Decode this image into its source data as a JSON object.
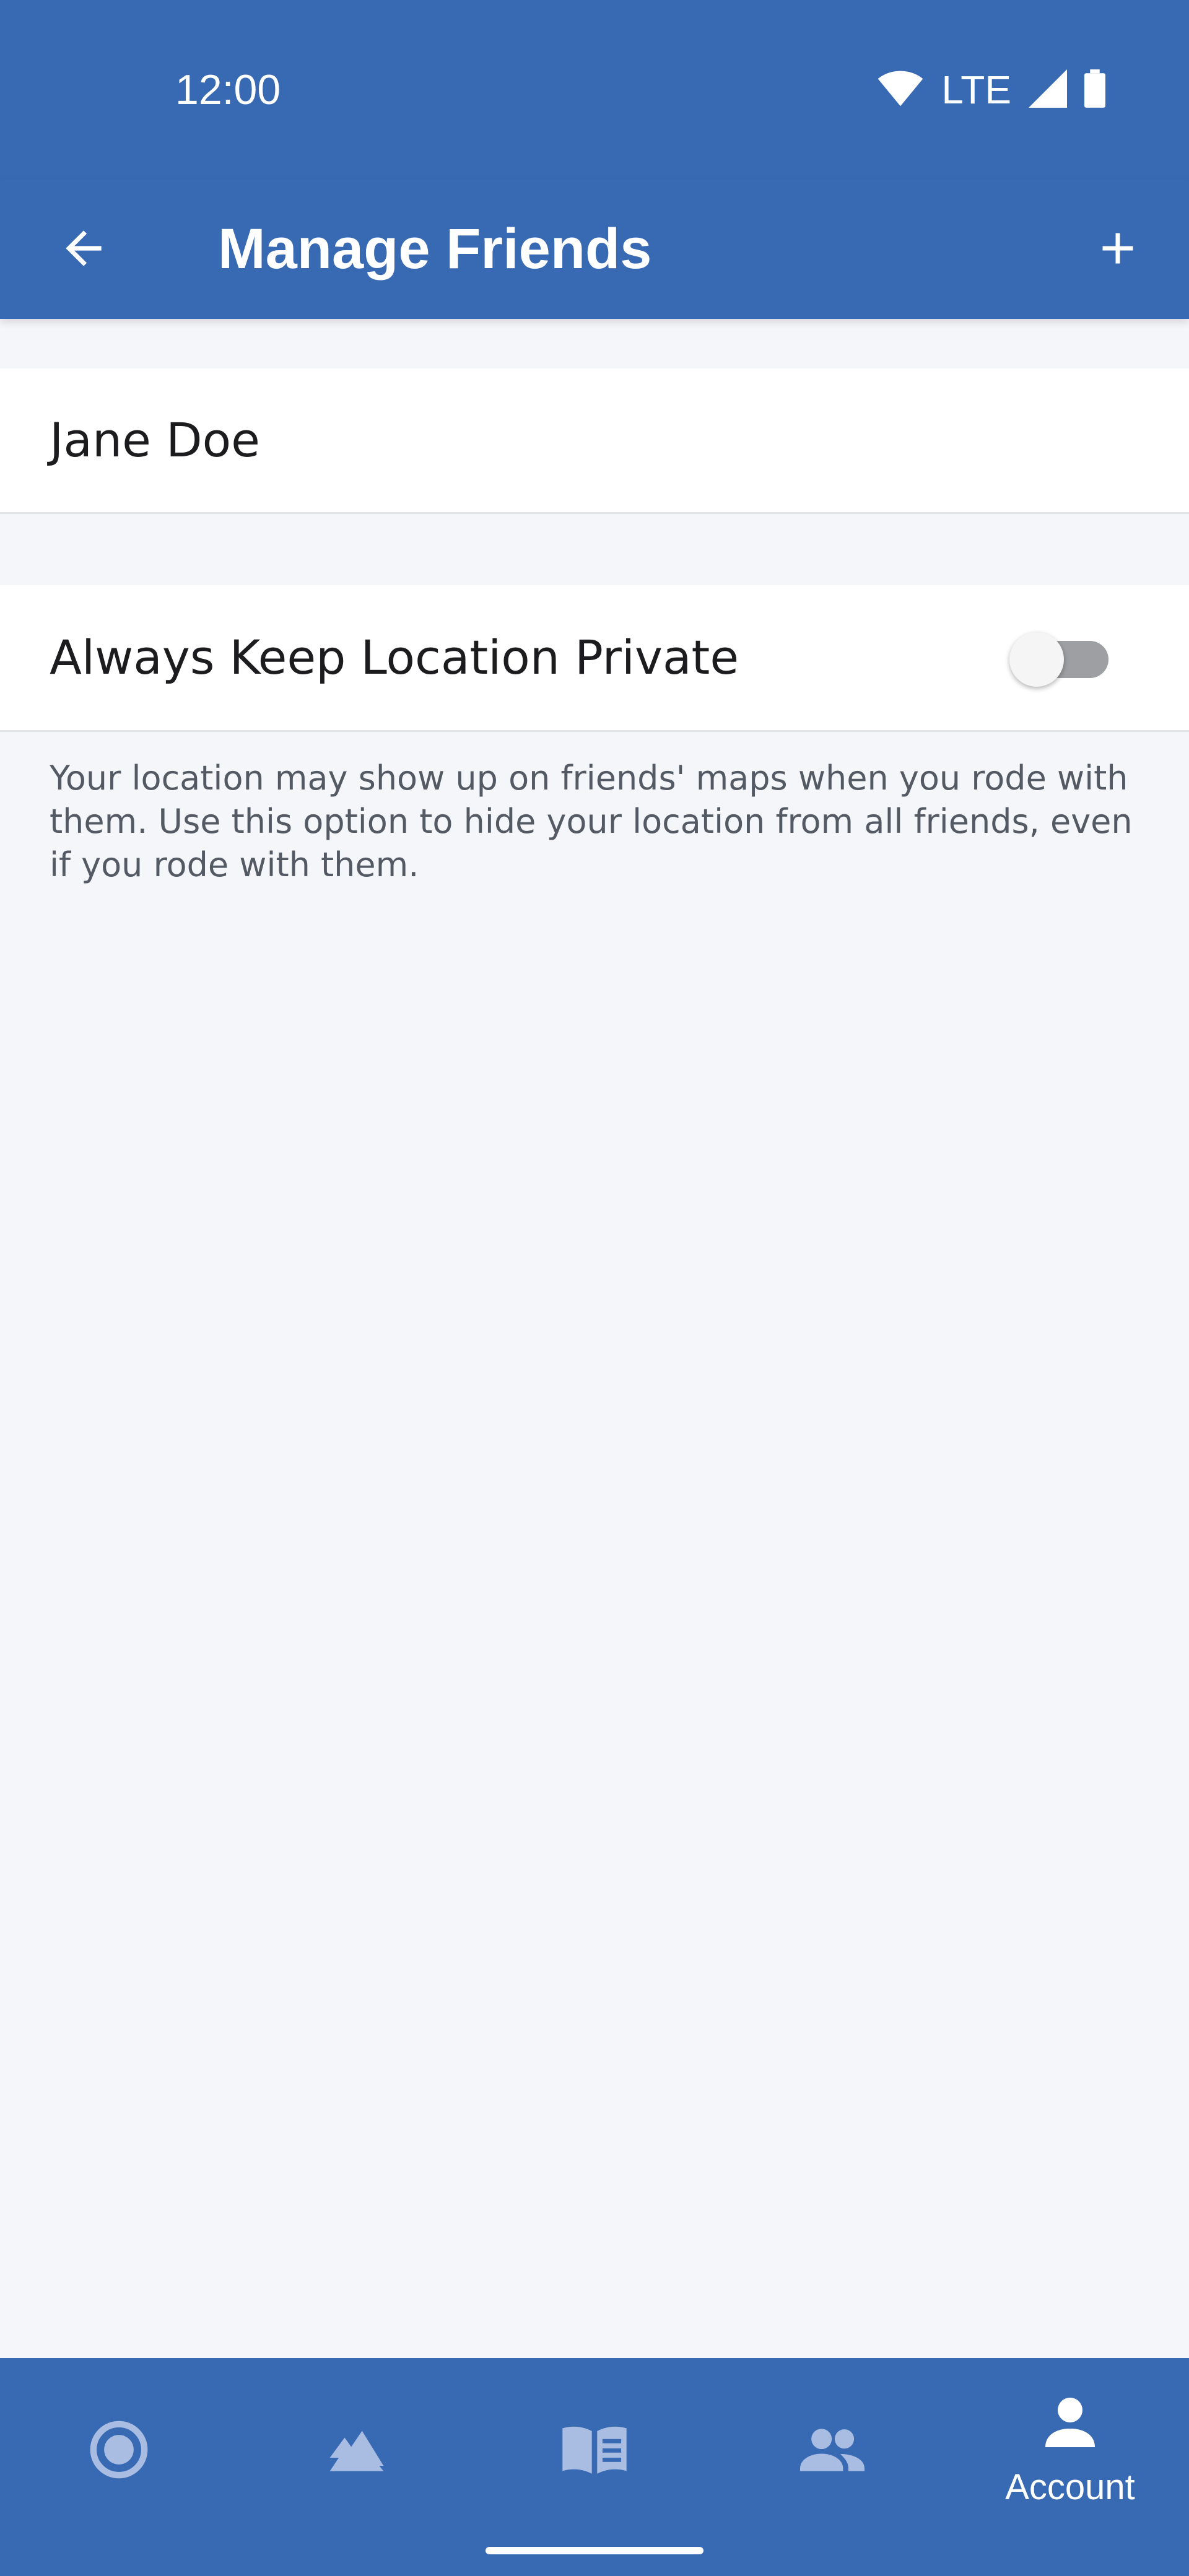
{
  "status_bar": {
    "time": "12:00",
    "network": "LTE",
    "icons": [
      "wifi-icon",
      "signal-icon",
      "battery-icon"
    ]
  },
  "app_bar": {
    "title": "Manage Friends",
    "back_icon": "arrow-back-icon",
    "add_icon": "plus-icon"
  },
  "friends": [
    {
      "name": "Jane Doe"
    }
  ],
  "privacy": {
    "label": "Always Keep Location Private",
    "enabled": false,
    "helper_text": "Your location may show up on friends' maps when you rode with them. Use this option to hide your location from all friends, even if you rode with them."
  },
  "bottom_nav": {
    "items": [
      {
        "icon": "record-icon",
        "label": ""
      },
      {
        "icon": "mountain-icon",
        "label": ""
      },
      {
        "icon": "book-icon",
        "label": ""
      },
      {
        "icon": "people-icon",
        "label": ""
      },
      {
        "icon": "person-icon",
        "label": "Account",
        "selected": true
      }
    ]
  },
  "colors": {
    "primary": "#3869b3",
    "background": "#f4f6fa",
    "inactive_icon": "#a9bde3",
    "active_icon": "#ffffff"
  }
}
